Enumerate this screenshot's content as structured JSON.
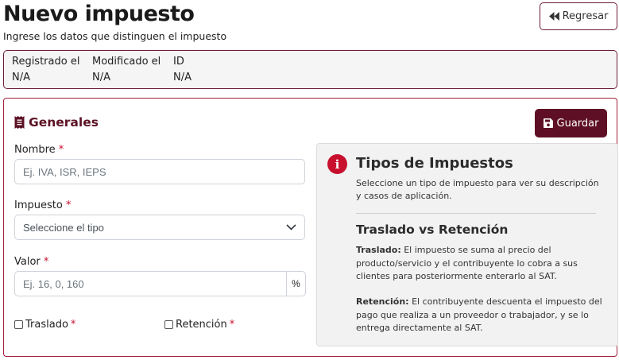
{
  "header": {
    "title": "Nuevo impuesto",
    "subtitle": "Ingrese los datos que distinguen el impuesto",
    "back_label": "Regresar",
    "back_icon": "backward-icon"
  },
  "meta": [
    {
      "label": "Registrado el",
      "value": "N/A"
    },
    {
      "label": "Modificado el",
      "value": "N/A"
    },
    {
      "label": "ID",
      "value": "N/A"
    }
  ],
  "card": {
    "title": "Generales",
    "title_icon": "receipt-icon",
    "save_label": "Guardar",
    "save_icon": "floppy-disk-icon"
  },
  "form": {
    "nombre": {
      "label": "Nombre",
      "required": "*",
      "placeholder": "Ej. IVA, ISR, IEPS"
    },
    "impuesto": {
      "label": "Impuesto",
      "required": "*",
      "selected": "Seleccione el tipo"
    },
    "valor": {
      "label": "Valor",
      "required": "*",
      "placeholder": "Ej. 16, 0, 160",
      "addon": "%"
    },
    "traslado": {
      "label": "Traslado",
      "required": "*",
      "checked": false
    },
    "retencion": {
      "label": "Retención",
      "required": "*",
      "checked": false
    }
  },
  "info": {
    "title": "Tipos de Impuestos",
    "description": "Seleccione un tipo de impuesto para ver su descripción y casos de aplicación.",
    "subtitle": "Traslado vs Retención",
    "traslado_term": "Traslado:",
    "traslado_text": "El impuesto se suma al precio del producto/servicio y el contribuyente lo cobra a sus clientes para posteriormente enterarlo al SAT.",
    "retencion_term": "Retención:",
    "retencion_text": "El contribuyente descuenta el impuesto del pago que realiza a un proveedor o trabajador, y se lo entrega directamente al SAT."
  },
  "colors": {
    "brand": "#5e0f25",
    "accent_border": "#a3223d",
    "required": "#c8102e",
    "info_icon": "#c8102e"
  }
}
